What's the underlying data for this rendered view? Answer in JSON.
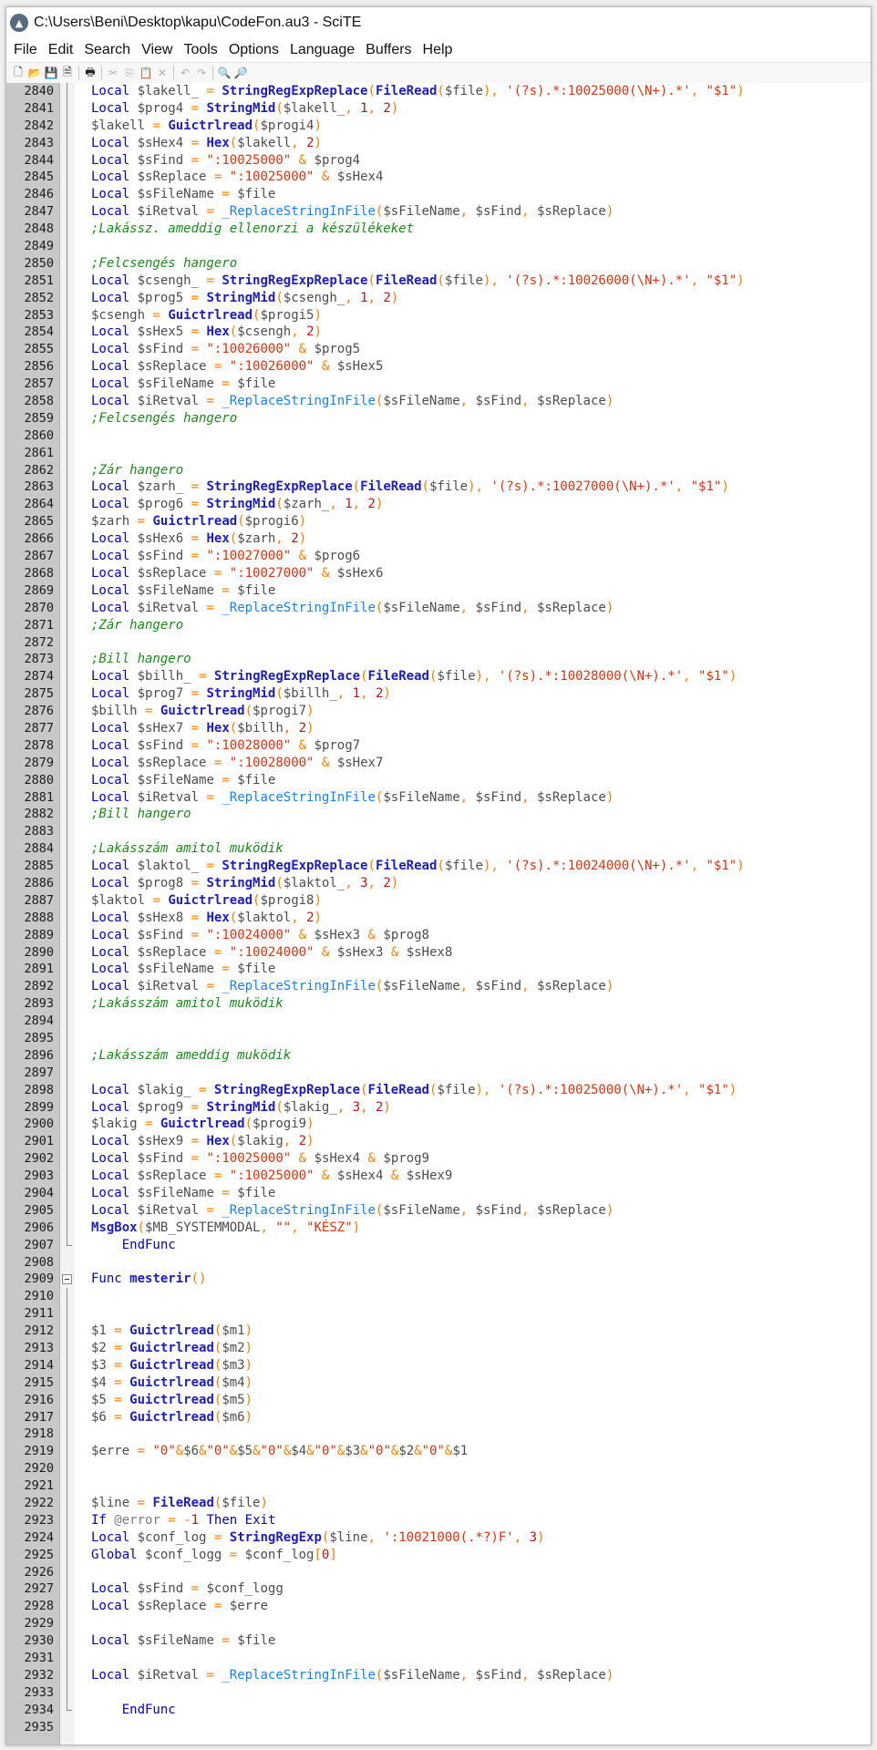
{
  "window": {
    "title": "C:\\Users\\Beni\\Desktop\\kapu\\CodeFon.au3 - SciTE",
    "app_icon": "scite-app-icon"
  },
  "menu": [
    "File",
    "Edit",
    "Search",
    "View",
    "Tools",
    "Options",
    "Language",
    "Buffers",
    "Help"
  ],
  "toolbar": [
    {
      "name": "new-file-icon",
      "glyph": "🗋",
      "enabled": true
    },
    {
      "name": "open-folder-icon",
      "glyph": "📂",
      "enabled": true
    },
    {
      "name": "save-icon",
      "glyph": "💾",
      "enabled": true
    },
    {
      "name": "close-file-icon",
      "glyph": "🗎",
      "enabled": true
    },
    {
      "sep": true
    },
    {
      "name": "print-icon",
      "glyph": "🖶",
      "enabled": true
    },
    {
      "sep": true
    },
    {
      "name": "cut-icon",
      "glyph": "✂",
      "enabled": false
    },
    {
      "name": "copy-icon",
      "glyph": "⎘",
      "enabled": false
    },
    {
      "name": "paste-icon",
      "glyph": "📋",
      "enabled": false
    },
    {
      "name": "delete-icon",
      "glyph": "✕",
      "enabled": false
    },
    {
      "sep": true
    },
    {
      "name": "undo-icon",
      "glyph": "↶",
      "enabled": false
    },
    {
      "name": "redo-icon",
      "glyph": "↷",
      "enabled": false
    },
    {
      "sep": true
    },
    {
      "name": "find-icon",
      "glyph": "🔍",
      "enabled": true
    },
    {
      "name": "replace-icon",
      "glyph": "🔎",
      "enabled": true
    }
  ],
  "editor": {
    "lines": [
      {
        "n": 2840,
        "t": "Local $lakell_ = StringRegExpReplace(FileRead($file), '(?s).*:10025000(\\N+).*', \"$1\")"
      },
      {
        "n": 2841,
        "t": "Local $prog4 = StringMid($lakell_, 1, 2)"
      },
      {
        "n": 2842,
        "t": "$lakell = Guictrlread($progi4)"
      },
      {
        "n": 2843,
        "t": "Local $sHex4 = Hex($lakell, 2)"
      },
      {
        "n": 2844,
        "t": "Local $sFind = \":10025000\" & $prog4"
      },
      {
        "n": 2845,
        "t": "Local $sReplace = \":10025000\" & $sHex4"
      },
      {
        "n": 2846,
        "t": "Local $sFileName = $file"
      },
      {
        "n": 2847,
        "t": "Local $iRetval = _ReplaceStringInFile($sFileName, $sFind, $sReplace)"
      },
      {
        "n": 2848,
        "t": ";Lakássz. ameddig ellenorzi a készülékeket"
      },
      {
        "n": 2849,
        "t": ""
      },
      {
        "n": 2850,
        "t": ";Felcsengés hangero"
      },
      {
        "n": 2851,
        "t": "Local $csengh_ = StringRegExpReplace(FileRead($file), '(?s).*:10026000(\\N+).*', \"$1\")"
      },
      {
        "n": 2852,
        "t": "Local $prog5 = StringMid($csengh_, 1, 2)"
      },
      {
        "n": 2853,
        "t": "$csengh = Guictrlread($progi5)"
      },
      {
        "n": 2854,
        "t": "Local $sHex5 = Hex($csengh, 2)"
      },
      {
        "n": 2855,
        "t": "Local $sFind = \":10026000\" & $prog5"
      },
      {
        "n": 2856,
        "t": "Local $sReplace = \":10026000\" & $sHex5"
      },
      {
        "n": 2857,
        "t": "Local $sFileName = $file"
      },
      {
        "n": 2858,
        "t": "Local $iRetval = _ReplaceStringInFile($sFileName, $sFind, $sReplace)"
      },
      {
        "n": 2859,
        "t": ";Felcsengés hangero"
      },
      {
        "n": 2860,
        "t": ""
      },
      {
        "n": 2861,
        "t": ""
      },
      {
        "n": 2862,
        "t": ";Zár hangero"
      },
      {
        "n": 2863,
        "t": "Local $zarh_ = StringRegExpReplace(FileRead($file), '(?s).*:10027000(\\N+).*', \"$1\")"
      },
      {
        "n": 2864,
        "t": "Local $prog6 = StringMid($zarh_, 1, 2)"
      },
      {
        "n": 2865,
        "t": "$zarh = Guictrlread($progi6)"
      },
      {
        "n": 2866,
        "t": "Local $sHex6 = Hex($zarh, 2)"
      },
      {
        "n": 2867,
        "t": "Local $sFind = \":10027000\" & $prog6"
      },
      {
        "n": 2868,
        "t": "Local $sReplace = \":10027000\" & $sHex6"
      },
      {
        "n": 2869,
        "t": "Local $sFileName = $file"
      },
      {
        "n": 2870,
        "t": "Local $iRetval = _ReplaceStringInFile($sFileName, $sFind, $sReplace)"
      },
      {
        "n": 2871,
        "t": ";Zár hangero"
      },
      {
        "n": 2872,
        "t": ""
      },
      {
        "n": 2873,
        "t": ";Bill hangero"
      },
      {
        "n": 2874,
        "t": "Local $billh_ = StringRegExpReplace(FileRead($file), '(?s).*:10028000(\\N+).*', \"$1\")"
      },
      {
        "n": 2875,
        "t": "Local $prog7 = StringMid($billh_, 1, 2)"
      },
      {
        "n": 2876,
        "t": "$billh = Guictrlread($progi7)"
      },
      {
        "n": 2877,
        "t": "Local $sHex7 = Hex($billh, 2)"
      },
      {
        "n": 2878,
        "t": "Local $sFind = \":10028000\" & $prog7"
      },
      {
        "n": 2879,
        "t": "Local $sReplace = \":10028000\" & $sHex7"
      },
      {
        "n": 2880,
        "t": "Local $sFileName = $file"
      },
      {
        "n": 2881,
        "t": "Local $iRetval = _ReplaceStringInFile($sFileName, $sFind, $sReplace)"
      },
      {
        "n": 2882,
        "t": ";Bill hangero"
      },
      {
        "n": 2883,
        "t": ""
      },
      {
        "n": 2884,
        "t": ";Lakásszám amitol muködik"
      },
      {
        "n": 2885,
        "t": "Local $laktol_ = StringRegExpReplace(FileRead($file), '(?s).*:10024000(\\N+).*', \"$1\")"
      },
      {
        "n": 2886,
        "t": "Local $prog8 = StringMid($laktol_, 3, 2)"
      },
      {
        "n": 2887,
        "t": "$laktol = Guictrlread($progi8)"
      },
      {
        "n": 2888,
        "t": "Local $sHex8 = Hex($laktol, 2)"
      },
      {
        "n": 2889,
        "t": "Local $sFind = \":10024000\" & $sHex3 & $prog8"
      },
      {
        "n": 2890,
        "t": "Local $sReplace = \":10024000\" & $sHex3 & $sHex8"
      },
      {
        "n": 2891,
        "t": "Local $sFileName = $file"
      },
      {
        "n": 2892,
        "t": "Local $iRetval = _ReplaceStringInFile($sFileName, $sFind, $sReplace)"
      },
      {
        "n": 2893,
        "t": ";Lakásszám amitol muködik"
      },
      {
        "n": 2894,
        "t": ""
      },
      {
        "n": 2895,
        "t": ""
      },
      {
        "n": 2896,
        "t": ";Lakásszám ameddig muködik"
      },
      {
        "n": 2897,
        "t": ""
      },
      {
        "n": 2898,
        "t": "Local $lakig_ = StringRegExpReplace(FileRead($file), '(?s).*:10025000(\\N+).*', \"$1\")"
      },
      {
        "n": 2899,
        "t": "Local $prog9 = StringMid($lakig_, 3, 2)"
      },
      {
        "n": 2900,
        "t": "$lakig = Guictrlread($progi9)"
      },
      {
        "n": 2901,
        "t": "Local $sHex9 = Hex($lakig, 2)"
      },
      {
        "n": 2902,
        "t": "Local $sFind = \":10025000\" & $sHex4 & $prog9"
      },
      {
        "n": 2903,
        "t": "Local $sReplace = \":10025000\" & $sHex4 & $sHex9"
      },
      {
        "n": 2904,
        "t": "Local $sFileName = $file"
      },
      {
        "n": 2905,
        "t": "Local $iRetval = _ReplaceStringInFile($sFileName, $sFind, $sReplace)"
      },
      {
        "n": 2906,
        "t": "MsgBox($MB_SYSTEMMODAL, \"\", \"KÉSZ\")"
      },
      {
        "n": 2907,
        "t": "    EndFunc"
      },
      {
        "n": 2908,
        "t": ""
      },
      {
        "n": 2909,
        "t": "Func mesterir()"
      },
      {
        "n": 2910,
        "t": ""
      },
      {
        "n": 2911,
        "t": ""
      },
      {
        "n": 2912,
        "t": "$1 = Guictrlread($m1)"
      },
      {
        "n": 2913,
        "t": "$2 = Guictrlread($m2)"
      },
      {
        "n": 2914,
        "t": "$3 = Guictrlread($m3)"
      },
      {
        "n": 2915,
        "t": "$4 = Guictrlread($m4)"
      },
      {
        "n": 2916,
        "t": "$5 = Guictrlread($m5)"
      },
      {
        "n": 2917,
        "t": "$6 = Guictrlread($m6)"
      },
      {
        "n": 2918,
        "t": ""
      },
      {
        "n": 2919,
        "t": "$erre = \"0\"&$6&\"0\"&$5&\"0\"&$4&\"0\"&$3&\"0\"&$2&\"0\"&$1"
      },
      {
        "n": 2920,
        "t": ""
      },
      {
        "n": 2921,
        "t": ""
      },
      {
        "n": 2922,
        "t": "$line = FileRead($file)"
      },
      {
        "n": 2923,
        "t": "If @error = -1 Then Exit"
      },
      {
        "n": 2924,
        "t": "Local $conf_log = StringRegExp($line, ':10021000(.*?)F', 3)"
      },
      {
        "n": 2925,
        "t": "Global $conf_logg = $conf_log[0]"
      },
      {
        "n": 2926,
        "t": ""
      },
      {
        "n": 2927,
        "t": "Local $sFind = $conf_logg"
      },
      {
        "n": 2928,
        "t": "Local $sReplace = $erre"
      },
      {
        "n": 2929,
        "t": ""
      },
      {
        "n": 2930,
        "t": "Local $sFileName = $file"
      },
      {
        "n": 2931,
        "t": ""
      },
      {
        "n": 2932,
        "t": "Local $iRetval = _ReplaceStringInFile($sFileName, $sFind, $sReplace)"
      },
      {
        "n": 2933,
        "t": ""
      },
      {
        "n": 2934,
        "t": "    EndFunc"
      },
      {
        "n": 2935,
        "t": ""
      }
    ]
  },
  "colors": {
    "keyword": "#0000c8",
    "function": "#1d1dc6",
    "string": "#e0300d",
    "number": "#b01a1a",
    "operator": "#ff8000",
    "comment": "#1a8a1a",
    "udf": "#1a7fff",
    "gutter": "#c8c8c8"
  }
}
